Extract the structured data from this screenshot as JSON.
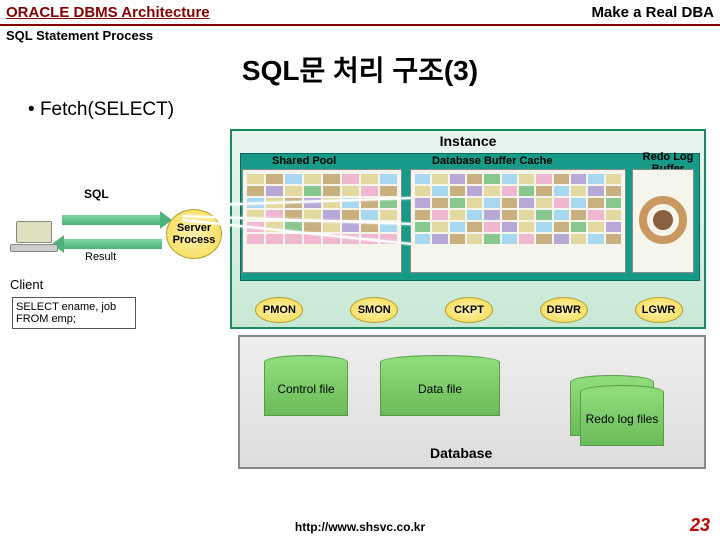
{
  "header": {
    "left": "ORACLE DBMS Architecture",
    "right": "Make a Real DBA"
  },
  "subhead": "SQL Statement Process",
  "title": "SQL문 처리 구조(3)",
  "bullet": "Fetch(SELECT)",
  "labels": {
    "sql": "SQL",
    "result": "Result",
    "client": "Client",
    "server_process": "Server Process",
    "instance": "Instance",
    "shared_pool": "Shared Pool",
    "db_cache": "Database Buffer Cache",
    "redo_log": "Redo Log Buffer",
    "control_file": "Control file",
    "data_file": "Data file",
    "redo_files": "Redo log files",
    "database": "Database"
  },
  "bg_processes": [
    "PMON",
    "SMON",
    "CKPT",
    "DBWR",
    "LGWR"
  ],
  "statement": "SELECT ename, job FROM emp;",
  "footer": {
    "url": "http://www.shsvc.co.kr",
    "page": "23"
  }
}
